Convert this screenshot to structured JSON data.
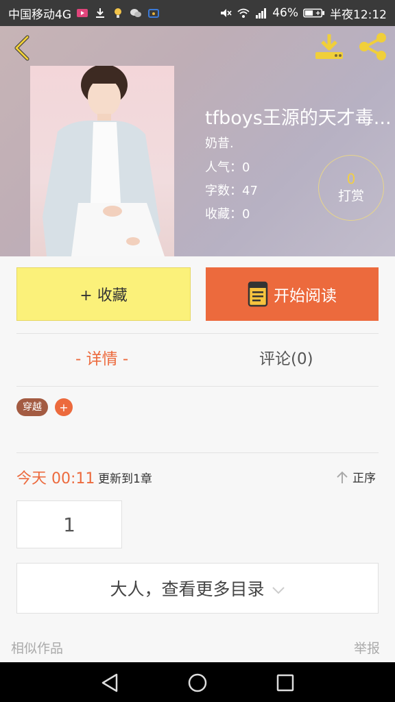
{
  "status_bar": {
    "carrier": "中国移动4G",
    "battery": "46%",
    "time": "半夜12:12",
    "icons": [
      "video-app-icon",
      "download-icon",
      "bulb-icon",
      "wechat-icon",
      "vpn-icon",
      "mute-icon",
      "wifi-icon",
      "signal-icon",
      "battery-icon"
    ]
  },
  "book": {
    "title": "tfboys王源的天才毒...",
    "author": "奶昔.",
    "popularity": "人气：0",
    "word_count": "字数：47",
    "collections": "收藏：0"
  },
  "tip": {
    "count": "0",
    "label": "打赏"
  },
  "actions": {
    "collect": "+ 收藏",
    "read": "开始阅读"
  },
  "tabs": {
    "detail": "- 详情 -",
    "comments": "评论(0)"
  },
  "tags": [
    {
      "label": "穿越"
    }
  ],
  "tag_add": "+",
  "update": {
    "day": "今天 00:11",
    "desc": "更新到1章",
    "sort": "正序"
  },
  "chapters": [
    {
      "label": "1"
    }
  ],
  "more_catalog": "大人，查看更多目录",
  "footer": {
    "similar": "相似作品",
    "report": "举报"
  },
  "colors": {
    "accent": "#ec6a3d",
    "collect_bg": "#fbf17a",
    "tag_bg": "#a35b42",
    "tip_count": "#f2cf45"
  }
}
